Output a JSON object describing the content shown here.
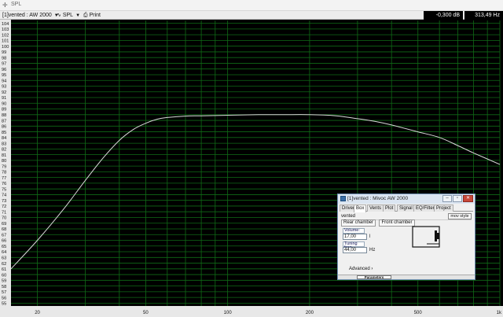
{
  "window": {
    "title": "SPL"
  },
  "toolbar": {
    "design_select": "[1]vented : AW 2000",
    "view_select": "SPL",
    "print_label": "Print",
    "readout_db": "-0,300 dB",
    "readout_hz": "313,49 Hz"
  },
  "chart_data": {
    "type": "line",
    "title": "",
    "xlabel": "",
    "ylabel": "",
    "xscale": "log",
    "xlim": [
      16,
      1000
    ],
    "ylim": [
      54.5,
      104.5
    ],
    "grid": true,
    "x_tick_labels": [
      {
        "value": 20,
        "label": "20"
      },
      {
        "value": 50,
        "label": "50"
      },
      {
        "value": 100,
        "label": "100"
      },
      {
        "value": 200,
        "label": "200"
      },
      {
        "value": 500,
        "label": "500"
      },
      {
        "value": 1000,
        "label": "1k"
      }
    ],
    "y_ticks": [
      55,
      56,
      57,
      58,
      59,
      60,
      61,
      62,
      63,
      64,
      65,
      66,
      67,
      68,
      69,
      70,
      71,
      72,
      73,
      74,
      75,
      76,
      77,
      78,
      79,
      80,
      81,
      82,
      83,
      84,
      85,
      86,
      87,
      88,
      89,
      90,
      91,
      92,
      93,
      94,
      95,
      96,
      97,
      98,
      99,
      100,
      101,
      102,
      103,
      104
    ],
    "series": [
      {
        "color": "#d8d8d8",
        "x": [
          16,
          20,
          25,
          30,
          35,
          40,
          45,
          50,
          55,
          60,
          70,
          80,
          100,
          130,
          160,
          200,
          250,
          300,
          350,
          400,
          500,
          600,
          700,
          800,
          1000
        ],
        "y": [
          61.0,
          66.0,
          71.5,
          76.5,
          80.5,
          83.5,
          85.4,
          86.5,
          87.2,
          87.5,
          87.75,
          87.8,
          87.9,
          88.0,
          88.0,
          88.0,
          87.8,
          87.3,
          86.8,
          86.2,
          85.0,
          84.0,
          82.6,
          81.3,
          79.3
        ]
      }
    ]
  },
  "dialog": {
    "title": "[1]vented : Mivoc AW 2000",
    "tabs": [
      "Driver",
      "Box",
      "Vents",
      "Plot",
      "Signal",
      "EQ/Filter",
      "Project"
    ],
    "active_tab": "Box",
    "alignment": "vented",
    "more_button": "mov style",
    "rear_chamber": "Rear chamber",
    "front_chamber": "Front chamber",
    "volume_label": "Volume:",
    "volume_value": "17,00",
    "volume_unit": "l",
    "tuning_label": "Tuning freq.",
    "tuning_value": "44,00",
    "tuning_unit": "Hz",
    "advanced": "Advanced ›",
    "status_tab": "Parameters"
  }
}
